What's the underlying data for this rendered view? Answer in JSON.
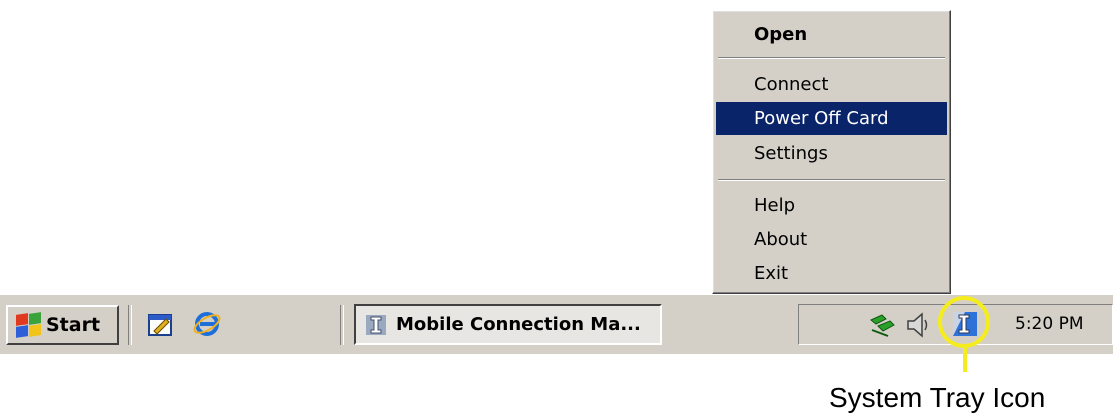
{
  "context_menu": {
    "items": [
      {
        "label": "Open",
        "bold": true
      },
      {
        "label": "Connect"
      },
      {
        "label": "Power Off Card",
        "highlighted": true
      },
      {
        "label": "Settings"
      },
      {
        "label": "Help"
      },
      {
        "label": "About"
      },
      {
        "label": "Exit"
      }
    ]
  },
  "taskbar": {
    "start_label": "Start",
    "quick_launch_icons": [
      "show-desktop-icon",
      "internet-explorer-icon"
    ],
    "task_button_label": "Mobile Connection Ma...",
    "tray_icons": [
      "network-icon",
      "volume-icon",
      "mobile-connection-icon"
    ],
    "clock": "5:20 PM"
  },
  "annotation": {
    "caption": "System Tray Icon",
    "highlight_color": "#f5ec1e"
  },
  "colors": {
    "menu_highlight": "#0a246a",
    "face": "#d4d0c8"
  }
}
